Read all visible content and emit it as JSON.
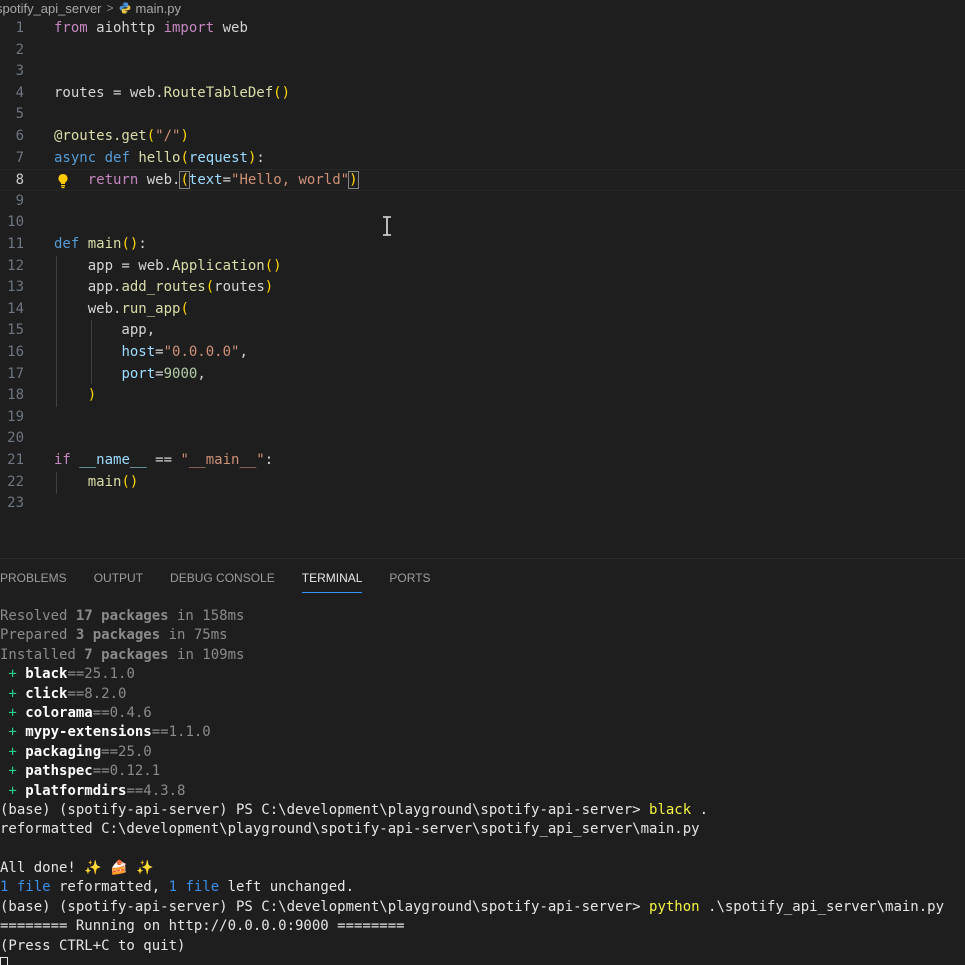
{
  "breadcrumb": {
    "folder": "spotify_api_server",
    "separator": ">",
    "file": "main.py",
    "file_icon": "python-icon"
  },
  "editor": {
    "current_line": 8,
    "line_numbers": [
      "1",
      "2",
      "3",
      "4",
      "5",
      "6",
      "7",
      "8",
      "9",
      "10",
      "11",
      "12",
      "13",
      "14",
      "15",
      "16",
      "17",
      "18",
      "19",
      "20",
      "21",
      "22",
      "23"
    ],
    "lines": [
      [
        [
          "k",
          "from"
        ],
        [
          "t",
          " aiohttp "
        ],
        [
          "k",
          "import"
        ],
        [
          "t",
          " web"
        ]
      ],
      [],
      [],
      [
        [
          "t",
          "routes = web."
        ],
        [
          "f",
          "RouteTableDef"
        ],
        [
          "p1",
          "()"
        ]
      ],
      [],
      [
        [
          "f",
          "@routes.get"
        ],
        [
          "p1",
          "("
        ],
        [
          "s",
          "\"/\""
        ],
        [
          "p1",
          ")"
        ]
      ],
      [
        [
          "d",
          "async"
        ],
        [
          "t",
          " "
        ],
        [
          "d",
          "def"
        ],
        [
          "t",
          " "
        ],
        [
          "f",
          "hello"
        ],
        [
          "p1",
          "("
        ],
        [
          "v",
          "request"
        ],
        [
          "p1",
          ")"
        ],
        [
          "t",
          ":"
        ]
      ],
      [
        [
          "t",
          "    "
        ],
        [
          "k",
          "return"
        ],
        [
          "t",
          " web."
        ],
        [
          "p1b",
          "("
        ],
        [
          "v",
          "text"
        ],
        [
          "t",
          "="
        ],
        [
          "s",
          "\"Hello, world\""
        ],
        [
          "p1b",
          ")"
        ]
      ],
      [],
      [],
      [
        [
          "d",
          "def"
        ],
        [
          "t",
          " "
        ],
        [
          "f",
          "main"
        ],
        [
          "p1",
          "()"
        ],
        [
          "t",
          ":"
        ]
      ],
      [
        [
          "t",
          "    app = web."
        ],
        [
          "f",
          "Application"
        ],
        [
          "p1",
          "()"
        ]
      ],
      [
        [
          "t",
          "    app."
        ],
        [
          "f",
          "add_routes"
        ],
        [
          "p1",
          "("
        ],
        [
          "t",
          "routes"
        ],
        [
          "p1",
          ")"
        ]
      ],
      [
        [
          "t",
          "    web."
        ],
        [
          "f",
          "run_app"
        ],
        [
          "p1",
          "("
        ]
      ],
      [
        [
          "t",
          "        app,"
        ]
      ],
      [
        [
          "t",
          "        "
        ],
        [
          "v",
          "host"
        ],
        [
          "t",
          "="
        ],
        [
          "s",
          "\"0.0.0.0\""
        ],
        [
          "t",
          ","
        ]
      ],
      [
        [
          "t",
          "        "
        ],
        [
          "v",
          "port"
        ],
        [
          "t",
          "="
        ],
        [
          "n",
          "9000"
        ],
        [
          "t",
          ","
        ]
      ],
      [
        [
          "t",
          "    "
        ],
        [
          "p1",
          ")"
        ]
      ],
      [],
      [],
      [
        [
          "k",
          "if"
        ],
        [
          "t",
          " "
        ],
        [
          "v",
          "__name__"
        ],
        [
          "t",
          " == "
        ],
        [
          "s",
          "\"__main__\""
        ],
        [
          "t",
          ":"
        ]
      ],
      [
        [
          "t",
          "    "
        ],
        [
          "f",
          "main"
        ],
        [
          "p1",
          "()"
        ]
      ],
      []
    ]
  },
  "panel": {
    "tabs": [
      {
        "label": "PROBLEMS",
        "active": false
      },
      {
        "label": "OUTPUT",
        "active": false
      },
      {
        "label": "DEBUG CONSOLE",
        "active": false
      },
      {
        "label": "TERMINAL",
        "active": true
      },
      {
        "label": "PORTS",
        "active": false
      }
    ]
  },
  "terminal": {
    "lines": [
      [
        [
          "dim",
          "Resolved "
        ],
        [
          "dimb",
          "17 packages"
        ],
        [
          "dim",
          " in 158ms"
        ]
      ],
      [
        [
          "dim",
          "Prepared "
        ],
        [
          "dimb",
          "3 packages"
        ],
        [
          "dim",
          " in 75ms"
        ]
      ],
      [
        [
          "dim",
          "Installed "
        ],
        [
          "dimb",
          "7 packages"
        ],
        [
          "dim",
          " in 109ms"
        ]
      ],
      [
        [
          "green",
          " + "
        ],
        [
          "b",
          "black"
        ],
        [
          "dim",
          "==25.1.0"
        ]
      ],
      [
        [
          "green",
          " + "
        ],
        [
          "b",
          "click"
        ],
        [
          "dim",
          "==8.2.0"
        ]
      ],
      [
        [
          "green",
          " + "
        ],
        [
          "b",
          "colorama"
        ],
        [
          "dim",
          "==0.4.6"
        ]
      ],
      [
        [
          "green",
          " + "
        ],
        [
          "b",
          "mypy-extensions"
        ],
        [
          "dim",
          "==1.1.0"
        ]
      ],
      [
        [
          "green",
          " + "
        ],
        [
          "b",
          "packaging"
        ],
        [
          "dim",
          "==25.0"
        ]
      ],
      [
        [
          "green",
          " + "
        ],
        [
          "b",
          "pathspec"
        ],
        [
          "dim",
          "==0.12.1"
        ]
      ],
      [
        [
          "green",
          " + "
        ],
        [
          "b",
          "platformdirs"
        ],
        [
          "dim",
          "==4.3.8"
        ]
      ],
      [
        [
          "white",
          "(base) (spotify-api-server) PS C:\\development\\playground\\spotify-api-server> "
        ],
        [
          "yellow",
          "black"
        ],
        [
          "white",
          " ."
        ]
      ],
      [
        [
          "white",
          "reformatted C:\\development\\playground\\spotify-api-server\\spotify_api_server\\main.py"
        ]
      ],
      [],
      [
        [
          "white",
          "All done! ✨ 🍰 ✨"
        ]
      ],
      [
        [
          "cyan",
          "1 file"
        ],
        [
          "white",
          " reformatted, "
        ],
        [
          "cyan",
          "1 file"
        ],
        [
          "white",
          " left unchanged."
        ]
      ],
      [
        [
          "white",
          "(base) (spotify-api-server) PS C:\\development\\playground\\spotify-api-server> "
        ],
        [
          "yellow",
          "python"
        ],
        [
          "white",
          " .\\spotify_api_server\\main.py"
        ]
      ],
      [
        [
          "white",
          "======== Running on http://0.0.0.0:9000 ========"
        ]
      ],
      [
        [
          "white",
          "(Press CTRL+C to quit)"
        ]
      ],
      [
        [
          "cursor",
          ""
        ]
      ]
    ]
  }
}
